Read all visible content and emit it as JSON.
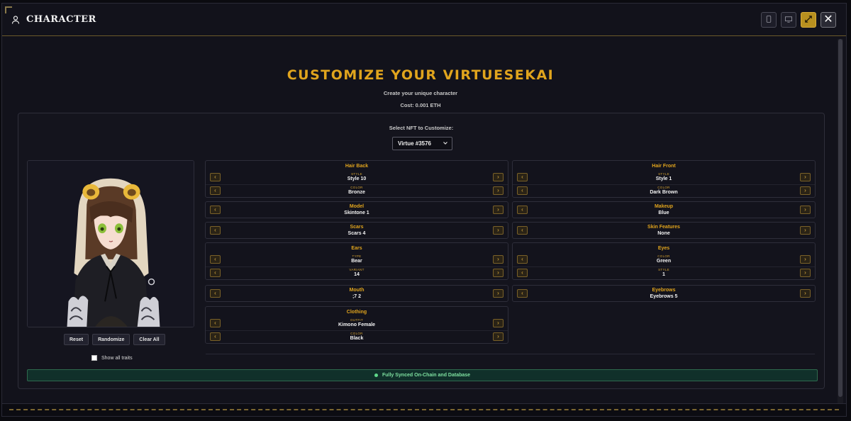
{
  "window": {
    "title": "CHARACTER",
    "buttons": [
      "mobile-view-icon",
      "desktop-view-icon",
      "fullscreen-icon",
      "close-icon"
    ]
  },
  "page": {
    "heading": "CUSTOMIZE YOUR VIRTUESEKAI",
    "subheading": "Create your unique character",
    "cost": "Cost: 0.001 ETH",
    "select_label": "Select NFT to Customize:",
    "selected_nft": "Virtue #3576"
  },
  "preview": {
    "reset": "Reset",
    "randomize": "Randomize",
    "clear_all": "Clear All",
    "show_all_traits": "Show all traits",
    "show_all_checked": false
  },
  "traits": {
    "hair_back": {
      "title": "Hair Back",
      "style_label": "STYLE",
      "style": "Style 10",
      "color_label": "COLOR",
      "color": "Bronze"
    },
    "hair_front": {
      "title": "Hair Front",
      "style_label": "STYLE",
      "style": "Style 1",
      "color_label": "COLOR",
      "color": "Dark Brown"
    },
    "model": {
      "title": "Model",
      "value": "Skintone 1"
    },
    "makeup": {
      "title": "Makeup",
      "value": "Blue"
    },
    "scars": {
      "title": "Scars",
      "value": "Scars 4"
    },
    "skin_features": {
      "title": "Skin Features",
      "value": "None"
    },
    "ears": {
      "title": "Ears",
      "type_label": "TYPE",
      "type": "Bear",
      "variant_label": "VARIANT",
      "variant": "14"
    },
    "eyes": {
      "title": "Eyes",
      "color_label": "COLOR",
      "color": "Green",
      "style_label": "STYLE",
      "style": "1"
    },
    "mouth": {
      "title": "Mouth",
      "value": ";7 2"
    },
    "eyebrows": {
      "title": "Eyebrows",
      "value": "Eyebrows 5"
    },
    "clothing": {
      "title": "Clothing",
      "outfit_label": "OUTFIT",
      "outfit": "Kimono Female",
      "color_label": "COLOR",
      "color": "Black"
    }
  },
  "status": {
    "text": "Fully Synced On-Chain and Database",
    "color": "#5fd88a"
  },
  "colors": {
    "accent": "#e0a41d",
    "background": "#12121b",
    "panel": "#14141d"
  }
}
